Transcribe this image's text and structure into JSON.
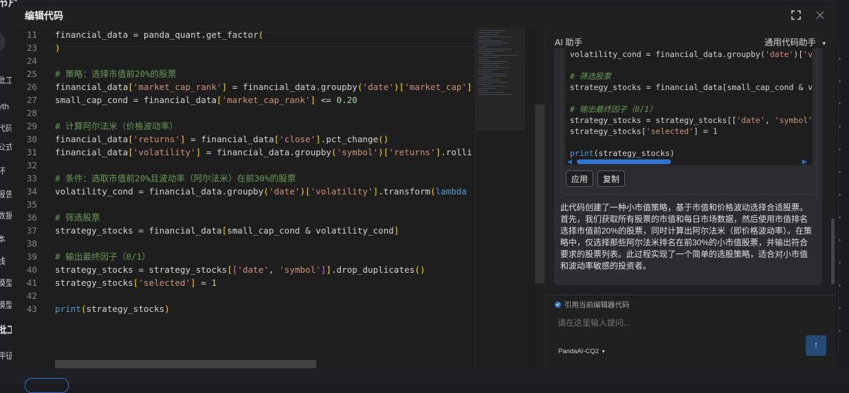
{
  "background": {
    "left_fragments": [
      "节户",
      "批工",
      "yth",
      "代码",
      "公式",
      "环",
      "报告",
      "数据",
      "本",
      "线",
      "模型",
      "模型",
      "批工",
      "评征"
    ]
  },
  "modal": {
    "title": "编辑代码",
    "icons": {
      "expand": "expand-icon",
      "close": "close-icon"
    }
  },
  "editor": {
    "lines": [
      {
        "n": "11",
        "html": "financial_data = panda_quant.get_factor<span class=\"tok-br\">(</span>"
      },
      {
        "n": "23",
        "html": "<span class=\"tok-br\">)</span>"
      },
      {
        "n": "24",
        "html": ""
      },
      {
        "n": "25",
        "html": "<span class=\"tok-com\"># 策略：选择市值前20%的股票</span>"
      },
      {
        "n": "26",
        "html": "financial_data<span class=\"tok-br\">[</span><span class=\"tok-str\">'market_cap_rank'</span><span class=\"tok-br\">]</span> = financial_data.groupby<span class=\"tok-br\">(</span><span class=\"tok-str\">'date'</span><span class=\"tok-br\">)</span><span class=\"tok-br\">[</span><span class=\"tok-str\">'market_cap'</span><span class=\"tok-br\">]</span>"
      },
      {
        "n": "27",
        "html": "small_cap_cond = financial_data<span class=\"tok-br\">[</span><span class=\"tok-str\">'market_cap_rank'</span><span class=\"tok-br\">]</span> &lt;= <span class=\"tok-num\">0.20</span>"
      },
      {
        "n": "28",
        "html": ""
      },
      {
        "n": "29",
        "html": "<span class=\"tok-com\"># 计算阿尔法米（价格波动率）</span>"
      },
      {
        "n": "30",
        "html": "financial_data<span class=\"tok-br\">[</span><span class=\"tok-str\">'returns'</span><span class=\"tok-br\">]</span> = financial_data<span class=\"tok-br\">[</span><span class=\"tok-str\">'close'</span><span class=\"tok-br\">]</span>.pct_change<span class=\"tok-br\">()</span>"
      },
      {
        "n": "31",
        "html": "financial_data<span class=\"tok-br\">[</span><span class=\"tok-str\">'volatility'</span><span class=\"tok-br\">]</span> = financial_data.groupby<span class=\"tok-br\">(</span><span class=\"tok-str\">'symbol'</span><span class=\"tok-br\">)</span><span class=\"tok-br\">[</span><span class=\"tok-str\">'returns'</span><span class=\"tok-br\">]</span>.rolli"
      },
      {
        "n": "32",
        "html": ""
      },
      {
        "n": "33",
        "html": "<span class=\"tok-com\"># 条件：选取市值前20%且波动率（阿尔法米）在前30%的股票</span>"
      },
      {
        "n": "34",
        "html": "volatility_cond = financial_data.groupby<span class=\"tok-br\">(</span><span class=\"tok-str\">'date'</span><span class=\"tok-br\">)</span><span class=\"tok-br\">[</span><span class=\"tok-str\">'volatility'</span><span class=\"tok-br\">]</span>.transform<span class=\"tok-br\">(</span><span class=\"tok-kw\">lambda</span>"
      },
      {
        "n": "35",
        "html": ""
      },
      {
        "n": "36",
        "html": "<span class=\"tok-com\"># 筛选股票</span>"
      },
      {
        "n": "37",
        "html": "strategy_stocks = financial_data<span class=\"tok-br\">[</span>small_cap_cond &amp; volatility_cond<span class=\"tok-br\">]</span>"
      },
      {
        "n": "38",
        "html": ""
      },
      {
        "n": "39",
        "html": "<span class=\"tok-com\"># 输出最终因子（0/1）</span>"
      },
      {
        "n": "40",
        "html": "strategy_stocks = strategy_stocks<span class=\"tok-br\">[</span><span class=\"tok-br2\">[</span><span class=\"tok-str\">'date'</span>, <span class=\"tok-str\">'symbol'</span><span class=\"tok-br2\">]</span><span class=\"tok-br\">]</span>.drop_duplicates<span class=\"tok-br\">()</span>"
      },
      {
        "n": "41",
        "html": "strategy_stocks<span class=\"tok-br\">[</span><span class=\"tok-str\">'selected'</span><span class=\"tok-br\">]</span> = <span class=\"tok-num\">1</span>"
      },
      {
        "n": "42",
        "html": ""
      },
      {
        "n": "43",
        "html": "<span class=\"tok-kw\">print</span><span class=\"tok-br\">(</span>strategy_stocks<span class=\"tok-br\">)</span>"
      }
    ]
  },
  "ai": {
    "title": "AI 助手",
    "selector": "通用代码助手",
    "code_lines": [
      {
        "html": "volatility_cond = financial_data.groupby(<span class=\"tok-str\">'date'</span>)[<span class=\"tok-str\">'vol</span>"
      },
      {
        "html": ""
      },
      {
        "html": "<span class=\"tok-com\"><i># 筛选股票</i></span>"
      },
      {
        "html": "strategy_stocks = financial_data[small_cap_cond &amp; vol"
      },
      {
        "html": ""
      },
      {
        "html": "<span class=\"tok-com\"><i># 输出最终因子（0/1）</i></span>"
      },
      {
        "html": "strategy_stocks = strategy_stocks[[<span class=\"tok-str\">'date'</span>, <span class=\"tok-str\">'symbol'</span>]]"
      },
      {
        "html": "strategy_stocks[<span class=\"tok-str\">'selected'</span>] = <span class=\"tok-num\">1</span>"
      },
      {
        "html": ""
      },
      {
        "html": "<span class=\"tok-kw\">print</span>(strategy_stocks)"
      }
    ],
    "apply_label": "应用",
    "copy_label": "复制",
    "description": "此代码创建了一种小市值策略，基于市值和价格波动选择合适股票。首先，我们获取所有股票的市值和每日市场数据，然后使用市值排名选择市值前20%的股票，同时计算出阿尔法米（即价格波动率）。在策略中，仅选择那些阿尔法米排名在前30%的小市值股票，并输出符合要求的股票列表。此过程实现了一个简单的选股策略，适合对小市值和波动率敏感的投资者。",
    "reference_label": "引用当前编辑器代码",
    "prompt_placeholder": "请在这里输入提问...",
    "model": "PandaAI-CQ2"
  }
}
